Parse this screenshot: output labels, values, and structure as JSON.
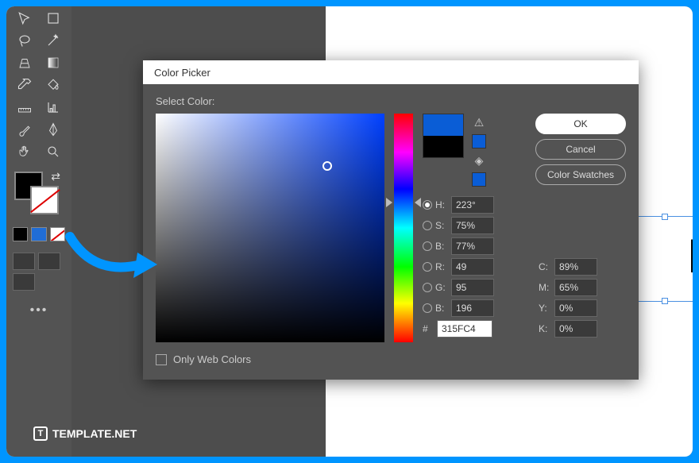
{
  "dialog": {
    "title": "Color Picker",
    "select_label": "Select Color:",
    "only_web": "Only Web Colors",
    "buttons": {
      "ok": "OK",
      "cancel": "Cancel",
      "swatches": "Color Swatches"
    },
    "hsb": {
      "h_label": "H:",
      "s_label": "S:",
      "b_label": "B:",
      "h": "223°",
      "s": "75%",
      "b": "77%"
    },
    "rgb": {
      "r_label": "R:",
      "g_label": "G:",
      "b_label": "B:",
      "r": "49",
      "g": "95",
      "b": "196"
    },
    "cmyk": {
      "c_label": "C:",
      "m_label": "M:",
      "y_label": "Y:",
      "k_label": "K:",
      "c": "89%",
      "m": "65%",
      "y": "0%",
      "k": "0%"
    },
    "hex_label": "#",
    "hex": "315FC4"
  },
  "watermark": "TEMPLATE.NET",
  "artboard_text": "E"
}
